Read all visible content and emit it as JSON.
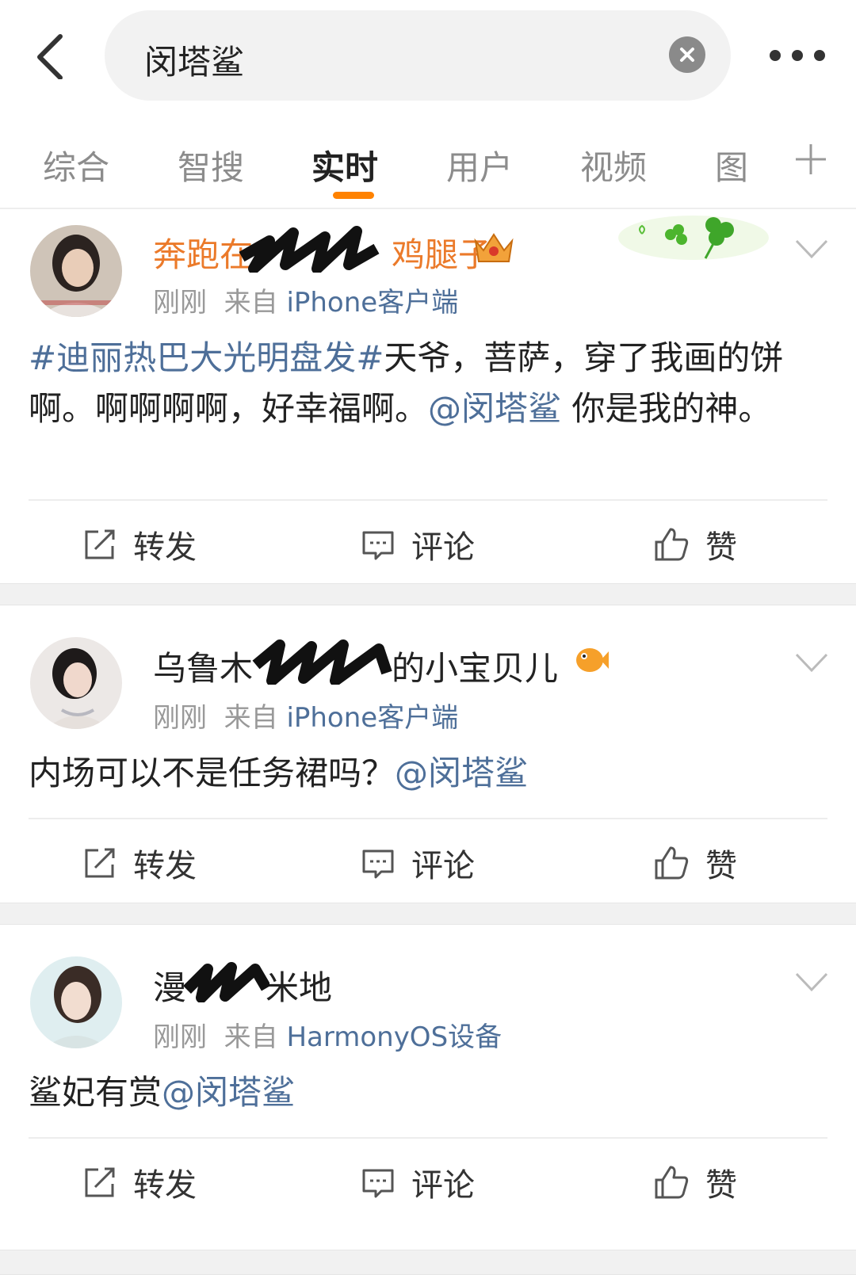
{
  "search": {
    "query": "闵塔鲨"
  },
  "tabs": [
    "综合",
    "智搜",
    "实时",
    "用户",
    "视频",
    "图"
  ],
  "active_tab": "实时",
  "colors": {
    "accent": "#ff8200",
    "link": "#4e6f99",
    "vip_name": "#eb7a2a"
  },
  "actions": {
    "repost": "转发",
    "comment": "评论",
    "like": "赞"
  },
  "posts": [
    {
      "name_parts": [
        "奔跑在",
        "鸡腿子"
      ],
      "time": "刚刚",
      "from_label": "来自",
      "source": "iPhone客户端",
      "hashtag": "#迪丽热巴大光明盘发#",
      "text1": "天爷，菩萨，穿了我画的饼啊。啊啊啊啊，好幸福啊。",
      "mention": "@闵塔鲨",
      "text2": " 你是我的神。"
    },
    {
      "name_parts": [
        "乌鲁木",
        "的小宝贝儿"
      ],
      "time": "刚刚",
      "from_label": "来自",
      "source": "iPhone客户端",
      "text1": "内场可以不是任务裙吗？",
      "mention": "@闵塔鲨"
    },
    {
      "name_parts": [
        "漫",
        "米地"
      ],
      "time": "刚刚",
      "from_label": "来自",
      "source": "HarmonyOS设备",
      "text1": "鲨妃有赏",
      "mention": "@闵塔鲨"
    }
  ]
}
